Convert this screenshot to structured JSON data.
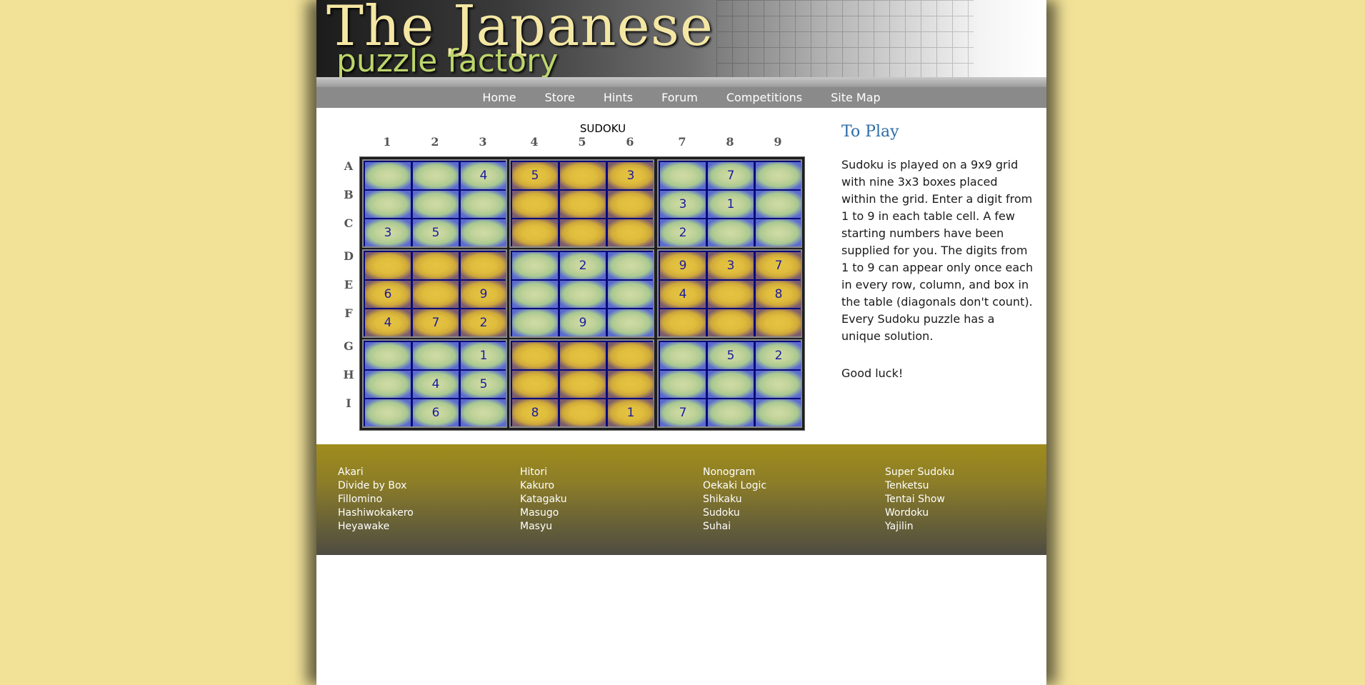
{
  "header": {
    "title": "The Japanese",
    "subtitle": "puzzle factory"
  },
  "nav": {
    "items": [
      "Home",
      "Store",
      "Hints",
      "Forum",
      "Competitions",
      "Site Map"
    ]
  },
  "puzzle": {
    "title": "SUDOKU",
    "columns": [
      "1",
      "2",
      "3",
      "4",
      "5",
      "6",
      "7",
      "8",
      "9"
    ],
    "rows": [
      "A",
      "B",
      "C",
      "D",
      "E",
      "F",
      "G",
      "H",
      "I"
    ],
    "grid": [
      [
        "",
        "",
        "4",
        "5",
        "",
        "3",
        "",
        "7",
        ""
      ],
      [
        "",
        "",
        "",
        "",
        "",
        "",
        "3",
        "1",
        ""
      ],
      [
        "3",
        "5",
        "",
        "",
        "",
        "",
        "2",
        "",
        ""
      ],
      [
        "",
        "",
        "",
        "",
        "2",
        "",
        "9",
        "3",
        "7"
      ],
      [
        "6",
        "",
        "9",
        "",
        "",
        "",
        "4",
        "",
        "8"
      ],
      [
        "4",
        "7",
        "2",
        "",
        "9",
        "",
        "",
        "",
        ""
      ],
      [
        "",
        "",
        "1",
        "",
        "",
        "",
        "",
        "5",
        "2"
      ],
      [
        "",
        "4",
        "5",
        "",
        "",
        "",
        "",
        "",
        ""
      ],
      [
        "",
        "6",
        "",
        "8",
        "",
        "1",
        "7",
        "",
        ""
      ]
    ],
    "box_colors": [
      [
        "green",
        "gold",
        "green"
      ],
      [
        "gold",
        "green",
        "gold"
      ],
      [
        "green",
        "gold",
        "green"
      ]
    ],
    "colors": {
      "green_cell": "#c2d39a",
      "gold_cell": "#e0bd3c",
      "digit": "#1a1a9e",
      "grid_lines": "#0a0a7a"
    }
  },
  "side": {
    "title": "To Play",
    "body": "Sudoku is played on a 9x9 grid with nine 3x3 boxes placed within the grid. Enter a digit from 1 to 9 in each table cell. A few starting numbers have been supplied for you. The digits from 1 to 9 can appear only once each in every row, column, and box in the table (diagonals don't count). Every Sudoku puzzle has a unique solution.",
    "closing": "Good luck!"
  },
  "footer": {
    "columns": [
      [
        "Akari",
        "Divide by Box",
        "Fillomino",
        "Hashiwokakero",
        "Heyawake"
      ],
      [
        "Hitori",
        "Kakuro",
        "Katagaku",
        "Masugo",
        "Masyu"
      ],
      [
        "Nonogram",
        "Oekaki Logic",
        "Shikaku",
        "Sudoku",
        "Suhai"
      ],
      [
        "Super Sudoku",
        "Tenketsu",
        "Tentai Show",
        "Wordoku",
        "Yajilin"
      ]
    ]
  },
  "colors": {
    "background": "#f1e298",
    "nav": "#8a8a8a",
    "footer": "#8c7d28",
    "side_title": "#2b6ba6"
  }
}
